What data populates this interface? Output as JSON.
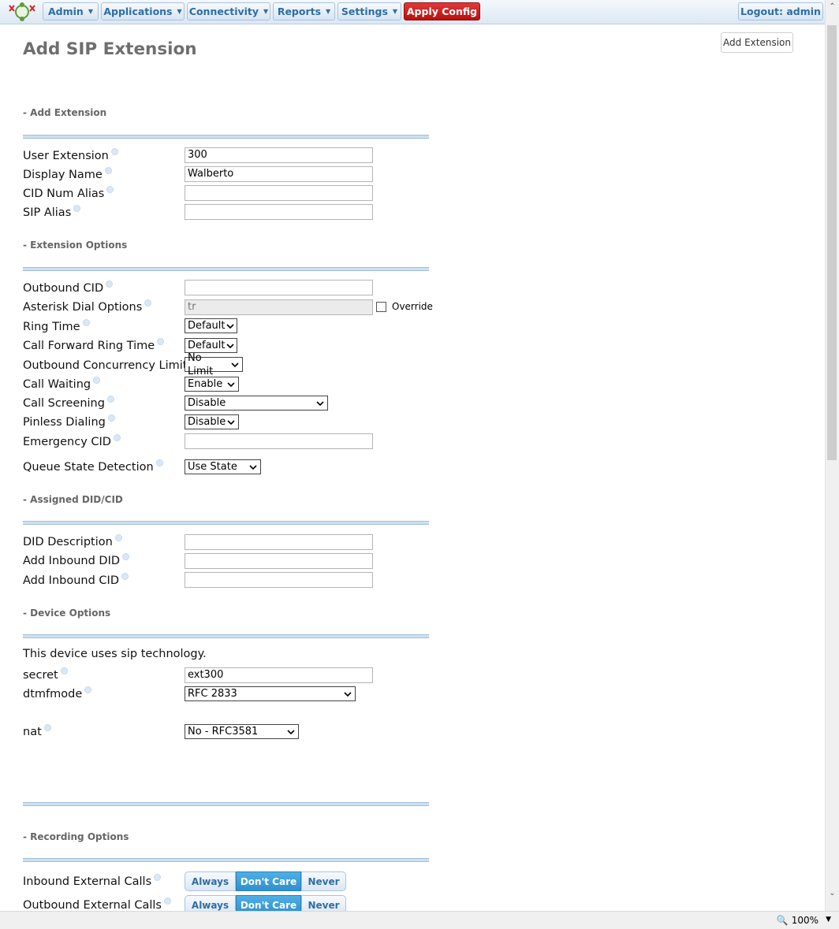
{
  "nav": {
    "items": [
      "Admin",
      "Applications",
      "Connectivity",
      "Reports",
      "Settings"
    ],
    "apply": "Apply Config",
    "logout": "Logout: admin"
  },
  "page": {
    "title": "Add SIP Extension",
    "add_button": "Add Extension"
  },
  "sections": {
    "add_extension": "- Add Extension",
    "extension_options": "- Extension Options",
    "assigned_did": "- Assigned DID/CID",
    "device_options": "- Device Options",
    "recording_options": "- Recording Options"
  },
  "fields": {
    "user_extension": {
      "label": "User Extension",
      "value": "300"
    },
    "display_name": {
      "label": "Display Name",
      "value": "Walberto"
    },
    "cid_num_alias": {
      "label": "CID Num Alias",
      "value": ""
    },
    "sip_alias": {
      "label": "SIP Alias",
      "value": ""
    },
    "outbound_cid": {
      "label": "Outbound CID",
      "value": ""
    },
    "asterisk_dial_options": {
      "label": "Asterisk Dial Options",
      "value": "tr",
      "override": "Override"
    },
    "ring_time": {
      "label": "Ring Time",
      "value": "Default"
    },
    "call_forward_ring_time": {
      "label": "Call Forward Ring Time",
      "value": "Default"
    },
    "outbound_concurrency": {
      "label": "Outbound Concurrency Limit",
      "value": "No Limit"
    },
    "call_waiting": {
      "label": "Call Waiting",
      "value": "Enable"
    },
    "call_screening": {
      "label": "Call Screening",
      "value": "Disable"
    },
    "pinless_dialing": {
      "label": "Pinless Dialing",
      "value": "Disable"
    },
    "emergency_cid": {
      "label": "Emergency CID",
      "value": ""
    },
    "queue_state": {
      "label": "Queue State Detection",
      "value": "Use State"
    },
    "did_description": {
      "label": "DID Description",
      "value": ""
    },
    "add_inbound_did": {
      "label": "Add Inbound DID",
      "value": ""
    },
    "add_inbound_cid": {
      "label": "Add Inbound CID",
      "value": ""
    },
    "device_note": "This device uses sip technology.",
    "secret": {
      "label": "secret",
      "value": "ext300"
    },
    "dtmfmode": {
      "label": "dtmfmode",
      "value": "RFC 2833"
    },
    "nat": {
      "label": "nat",
      "value": "No - RFC3581"
    }
  },
  "recording": {
    "options": [
      "Always",
      "Don't Care",
      "Never"
    ],
    "selected": "Don't Care",
    "inbound_external": "Inbound External Calls",
    "outbound_external": "Outbound External Calls"
  },
  "statusbar": {
    "zoom": "100%"
  }
}
